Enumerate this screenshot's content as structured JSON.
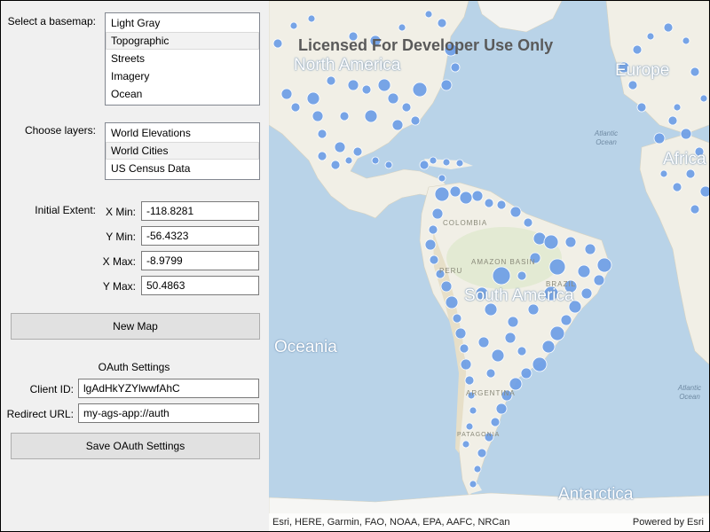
{
  "basemap": {
    "label": "Select a basemap:",
    "items": [
      "Light Gray",
      "Topographic",
      "Streets",
      "Imagery",
      "Ocean"
    ],
    "selected": 1
  },
  "layers": {
    "label": "Choose layers:",
    "items": [
      "World Elevations",
      "World Cities",
      "US Census Data"
    ],
    "selected": 1
  },
  "extent": {
    "label": "Initial Extent:",
    "xmin_label": "X Min:",
    "xmin": "-118.8281",
    "ymin_label": "Y Min:",
    "ymin": "-56.4323",
    "xmax_label": "X Max:",
    "xmax": "-8.9799",
    "ymax_label": "Y Max:",
    "ymax": "50.4863"
  },
  "new_map_label": "New Map",
  "oauth": {
    "title": "OAuth Settings",
    "client_id_label": "Client ID:",
    "client_id": "lgAdHkYZYlwwfAhC",
    "redirect_label": "Redirect URL:",
    "redirect": "my-ags-app://auth",
    "save_label": "Save OAuth Settings"
  },
  "map": {
    "watermark": "Licensed For Developer Use Only",
    "labels": {
      "north_america": "North America",
      "europe": "Europe",
      "africa": "Africa",
      "south_america": "South America",
      "oceania": "Oceania",
      "antarctica": "Antarctica",
      "atlantic_ocean_n": "Atlantic Ocean",
      "atlantic_ocean_s": "Atlantic Ocean",
      "amazon_basin": "AMAZON BASIN",
      "brazil": "BRAZIL",
      "colombia": "COLOMBIA",
      "peru": "PERU",
      "argentina": "ARGENTINA",
      "patagonia": "PATAGONIA"
    },
    "attribution": "Esri, HERE, Garmin, FAO, NOAA, EPA, AAFC, NRCan",
    "powered_by": "Powered by Esri",
    "land_color": "#f1efe6",
    "ocean_color": "#b9d3e8",
    "city_color": "#6c9de6"
  }
}
